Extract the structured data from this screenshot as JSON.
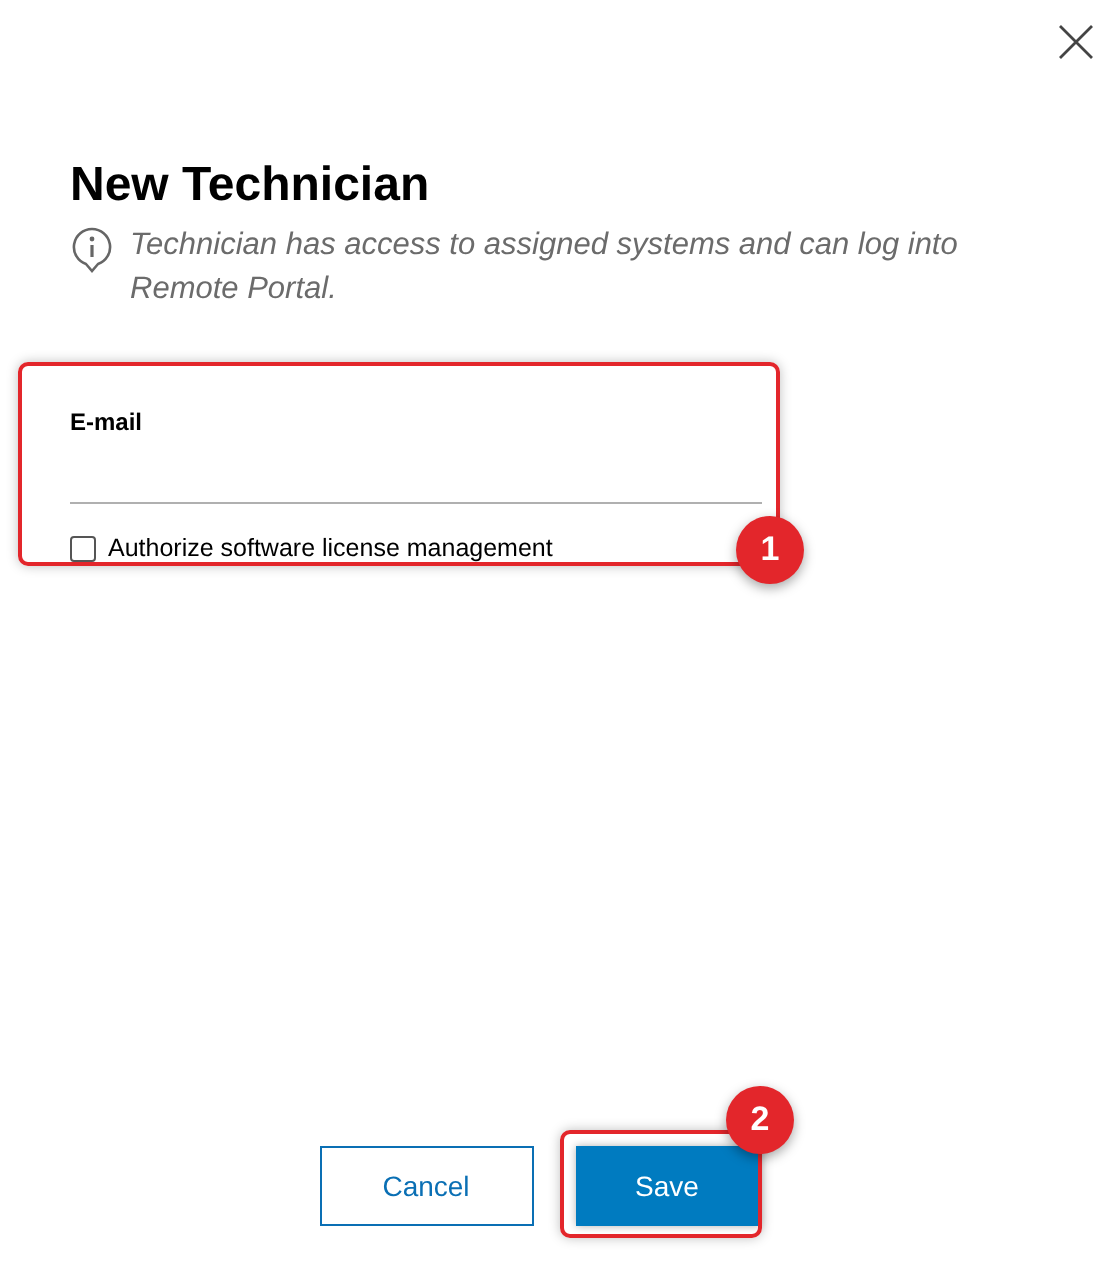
{
  "dialog": {
    "title": "New Technician",
    "info": "Technician has access to assigned systems and can log into Remote Portal."
  },
  "form": {
    "email": {
      "label": "E-mail"
    },
    "checkbox": {
      "label": "Authorize software license management",
      "checked": false
    }
  },
  "buttons": [
    {
      "label": "Cancel",
      "kind": "secondary"
    },
    {
      "label": "Save",
      "kind": "primary"
    }
  ],
  "annotations": [
    {
      "number": "1"
    },
    {
      "number": "2"
    }
  ]
}
